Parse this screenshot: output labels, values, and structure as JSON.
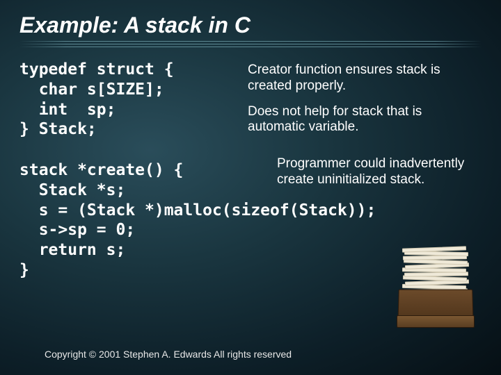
{
  "title": "Example: A stack in C",
  "code": {
    "typedef": "typedef struct {\n  char s[SIZE];\n  int  sp;\n} Stack;",
    "create": "stack *create() {\n  Stack *s;\n  s = (Stack *)malloc(sizeof(Stack));\n  s->sp = 0;\n  return s;\n}"
  },
  "notes": {
    "n1": "Creator function ensures stack is created properly.",
    "n2": "Does not help for stack that is automatic variable.",
    "n3": "Programmer could inadvertently create uninitialized stack."
  },
  "copyright": "Copyright © 2001 Stephen A. Edwards  All rights reserved",
  "image": {
    "alt": "paper-stack-in-drawer"
  }
}
